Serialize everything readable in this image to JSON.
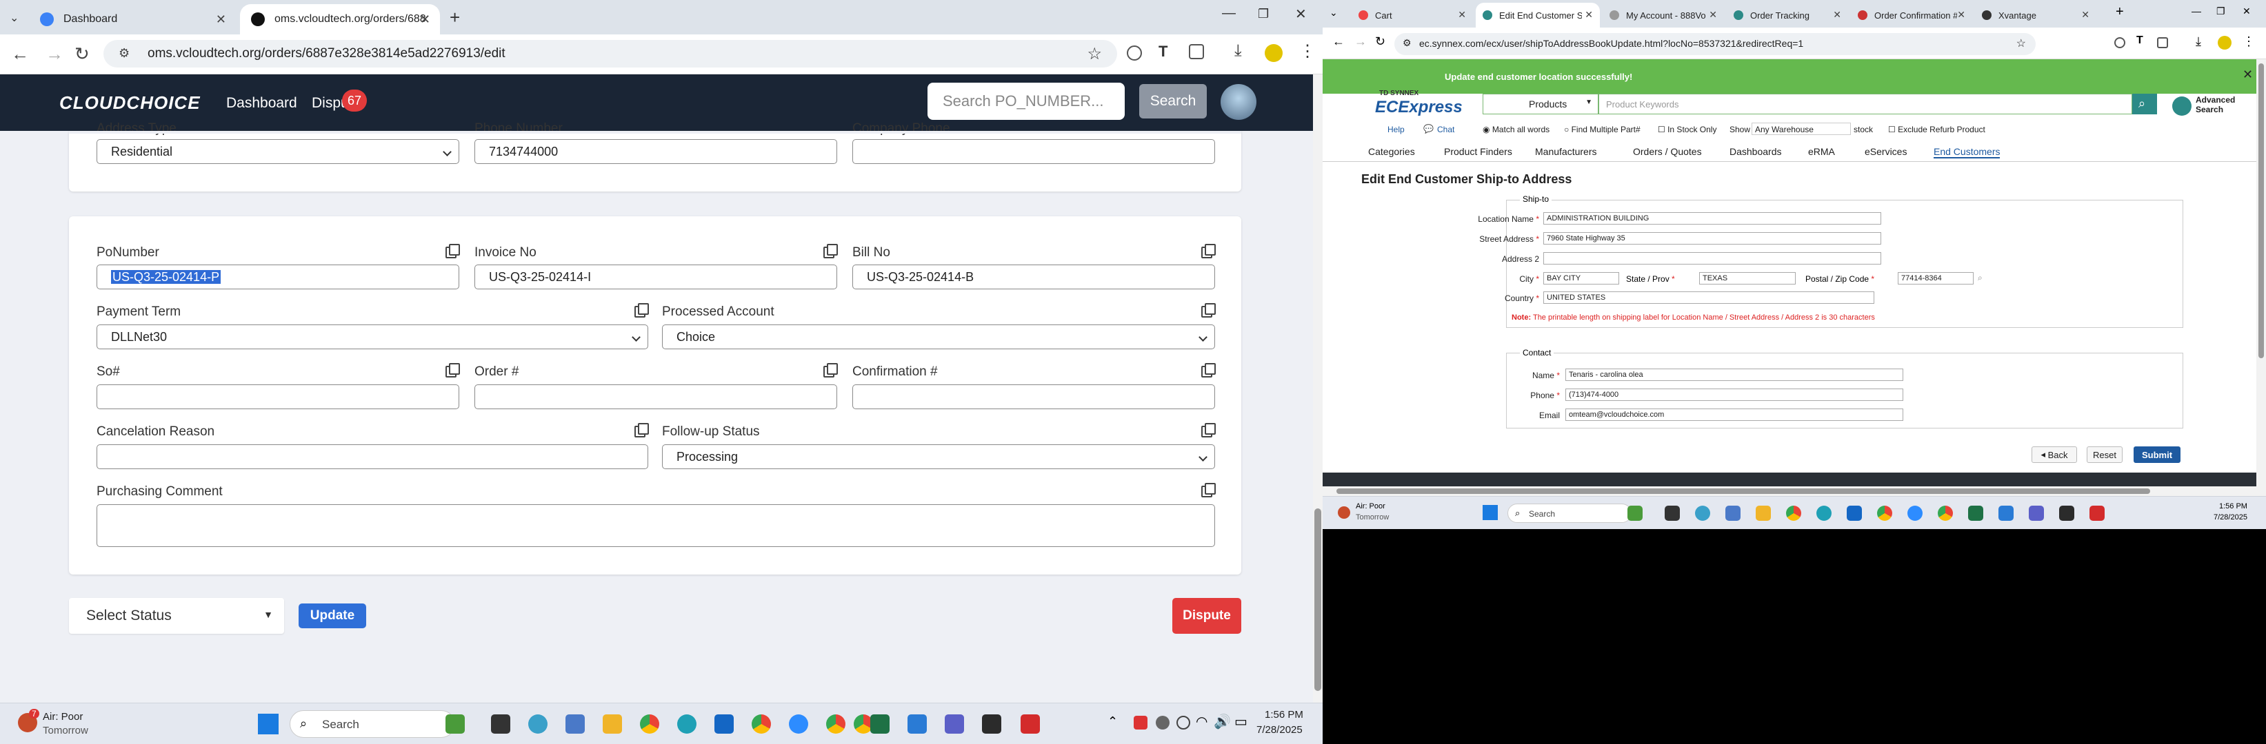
{
  "left": {
    "tabs": [
      {
        "label": "Dashboard",
        "active": false
      },
      {
        "label": "oms.vcloudtech.org/orders/688",
        "active": true
      }
    ],
    "new_tab": "+",
    "url": "oms.vcloudtech.org/orders/6887e328e3814e5ad2276913/edit",
    "app": {
      "logo": "CLOUDCHOICE",
      "nav_dashboard": "Dashboard",
      "nav_dispute": "Dispu",
      "dispute_badge": "67",
      "search_placeholder": "Search PO_NUMBER...",
      "search_button": "Search"
    },
    "top_card": {
      "address_type_label": "Address Type",
      "address_type_value": "Residential",
      "phone_label": "Phone Number",
      "phone_value": "7134744000",
      "company_phone_label": "Company Phone",
      "company_phone_value": ""
    },
    "form": {
      "po_number_label": "PoNumber",
      "po_number_value": "US-Q3-25-02414-P",
      "invoice_label": "Invoice No",
      "invoice_value": "US-Q3-25-02414-I",
      "bill_label": "Bill No",
      "bill_value": "US-Q3-25-02414-B",
      "payment_term_label": "Payment Term",
      "payment_term_value": "DLLNet30",
      "processed_account_label": "Processed Account",
      "processed_account_value": "Choice",
      "so_label": "So#",
      "so_value": "",
      "order_label": "Order #",
      "order_value": "",
      "confirmation_label": "Confirmation #",
      "confirmation_value": "",
      "cancel_reason_label": "Cancelation Reason",
      "cancel_reason_value": "",
      "followup_label": "Follow-up Status",
      "followup_value": "Processing",
      "comment_label": "Purchasing Comment",
      "comment_value": ""
    },
    "bottom": {
      "status_select": "Select Status",
      "update_button": "Update",
      "dispute_button": "Dispute"
    },
    "taskbar": {
      "weather_title": "Air: Poor",
      "weather_sub": "Tomorrow",
      "weather_badge": "7",
      "search": "Search",
      "time": "1:56 PM",
      "date": "7/28/2025"
    }
  },
  "right": {
    "tabs": [
      {
        "label": "Cart"
      },
      {
        "label": "Edit End Customer Sh"
      },
      {
        "label": "My Account - 888Vo"
      },
      {
        "label": "Order Tracking"
      },
      {
        "label": "Order Confirmation #"
      },
      {
        "label": "Xvantage"
      }
    ],
    "url": "ec.synnex.com/ecx/user/shipToAddressBookUpdate.html?locNo=8537321&redirectReq=1",
    "success_msg": "Update end customer location successfully!",
    "brand_top": "TD SYNNEX",
    "brand": "ECExpress",
    "products_select": "Products",
    "keywords_placeholder": "Product Keywords",
    "advanced_search": "Advanced Search",
    "help": "Help",
    "chat": "Chat",
    "match_all": "Match all words",
    "find_multiple": "Find Multiple Part#",
    "in_stock": "In Stock Only",
    "show": "Show",
    "warehouse": "Any Warehouse",
    "stock": "stock",
    "exclude_refurb": "Exclude Refurb Product",
    "menu": [
      "Categories",
      "Product Finders",
      "Manufacturers",
      "Orders / Quotes",
      "Dashboards",
      "eRMA",
      "eServices",
      "End Customers"
    ],
    "page_title": "Edit End Customer Ship-to Address",
    "shipto_legend": "Ship-to",
    "location_name_label": "Location Name",
    "location_name_value": "ADMINISTRATION BUILDING",
    "street_label": "Street Address",
    "street_value": "7960 State Highway 35",
    "address2_label": "Address 2",
    "address2_value": "",
    "city_label": "City",
    "city_value": "BAY CITY",
    "state_label": "State / Prov",
    "state_value": "TEXAS",
    "zip_label": "Postal / Zip Code",
    "zip_value": "77414-8364",
    "country_label": "Country",
    "country_value": "UNITED STATES",
    "note_label": "Note:",
    "note_text": "The printable length on shipping label for Location Name / Street Address / Address 2 is 30 characters",
    "contact_legend": "Contact",
    "name_label": "Name",
    "name_value": "Tenaris - carolina olea",
    "phone_label": "Phone",
    "phone_value": "(713)474-4000",
    "email_label": "Email",
    "email_value": "omteam@vcloudchoice.com",
    "back_button": "Back",
    "reset_button": "Reset",
    "submit_button": "Submit",
    "taskbar": {
      "weather_title": "Air: Poor",
      "weather_sub": "Tomorrow",
      "search": "Search",
      "time": "1:56 PM",
      "date": "7/28/2025"
    }
  }
}
